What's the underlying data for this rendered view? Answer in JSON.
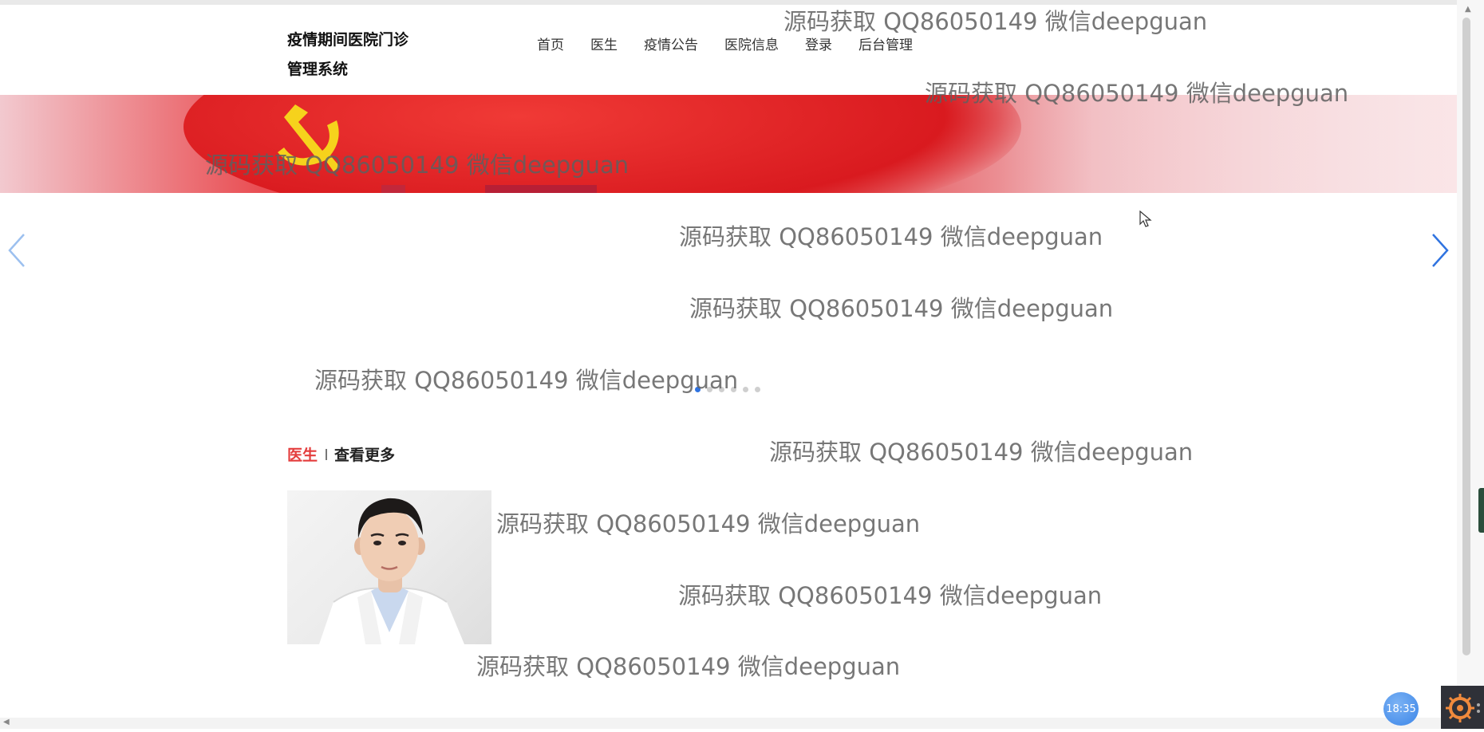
{
  "header": {
    "title_line1": "疫情期间医院门诊",
    "title_line2": "管理系统",
    "nav": [
      {
        "label": "首页"
      },
      {
        "label": "医生"
      },
      {
        "label": "疫情公告"
      },
      {
        "label": "医院信息"
      },
      {
        "label": "登录"
      },
      {
        "label": "后台管理"
      }
    ]
  },
  "carousel": {
    "slide_count": 6,
    "active_index": 0
  },
  "section": {
    "title": "医生",
    "more_label": "查看更多"
  },
  "watermark": {
    "text": "源码获取 QQ86050149 微信deepguan"
  },
  "taskbar": {
    "time": "18:35"
  },
  "colors": {
    "accent": "#e43d3d",
    "carousel_arrow": "#2f73e0",
    "banner_red": "#e22a2e"
  },
  "icons": [
    "chevron-left-icon",
    "chevron-right-icon",
    "party-emblem-icon",
    "doctor-photo",
    "clock-badge-icon",
    "app-tray-icon"
  ]
}
